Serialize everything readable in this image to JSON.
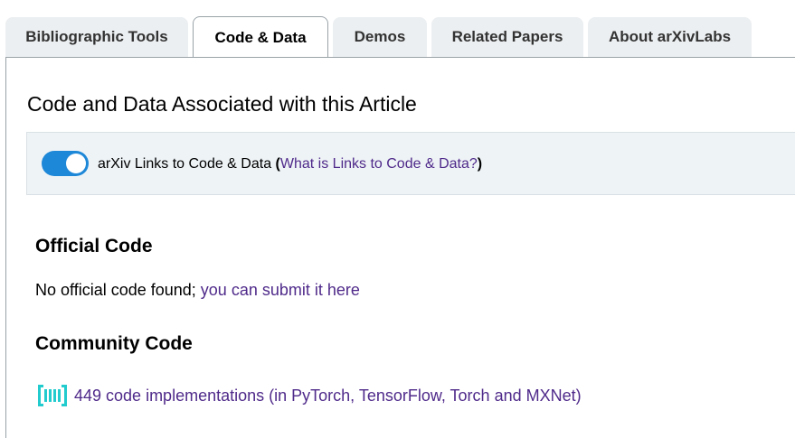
{
  "tabs": [
    {
      "label": "Bibliographic Tools"
    },
    {
      "label": "Code & Data"
    },
    {
      "label": "Demos"
    },
    {
      "label": "Related Papers"
    },
    {
      "label": "About arXivLabs"
    }
  ],
  "active_tab": "Code & Data",
  "heading": "Code and Data Associated with this Article",
  "toggle": {
    "label": "arXiv Links to Code & Data",
    "open_paren": "(",
    "help_link": "What is Links to Code & Data?",
    "close_paren": ")",
    "state": "on",
    "color": "#1e88d8"
  },
  "official_code": {
    "title": "Official Code",
    "text": "No official code found; ",
    "link": "you can submit it here"
  },
  "community_code": {
    "title": "Community Code",
    "icon": "papers-with-code-icon",
    "link": "449 code implementations (in PyTorch, TensorFlow, Torch and MXNet)"
  },
  "colors": {
    "link": "#4f2a8a",
    "icon": "#21cbce",
    "tab_bg": "#eceff1",
    "toggle_box_bg": "#eef3f6"
  }
}
